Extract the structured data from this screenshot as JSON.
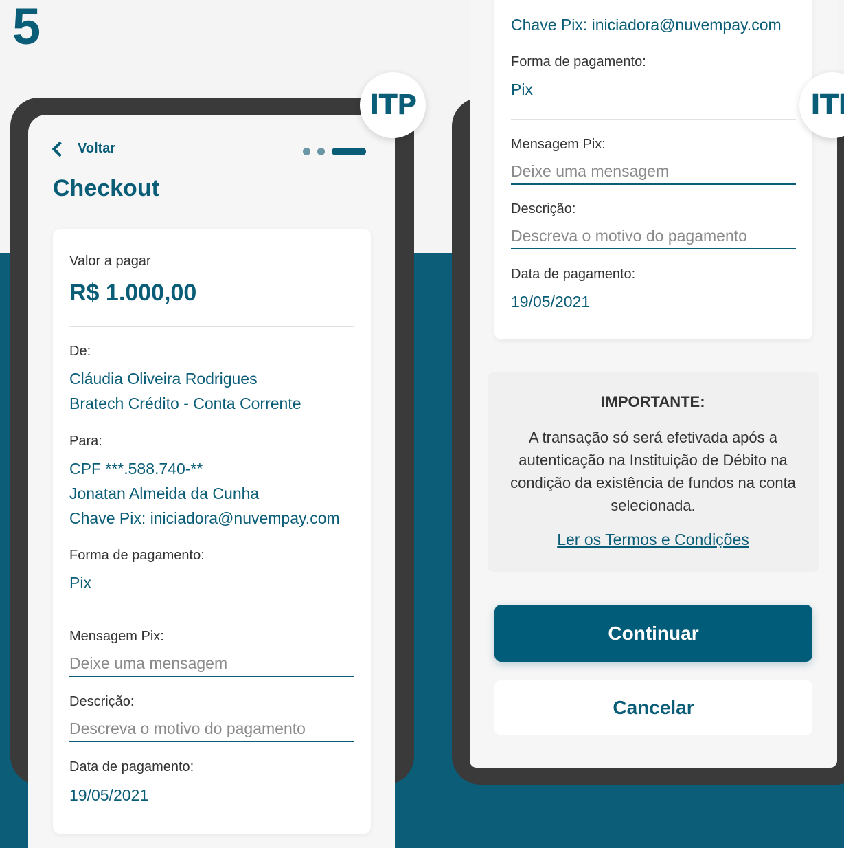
{
  "step_number": "5",
  "badge": "ITP",
  "badge_right": "ITI",
  "nav": {
    "back_label": "Voltar"
  },
  "page_title": "Checkout",
  "colors": {
    "brand": "#0a5d77",
    "background_band": "#0c5d78",
    "frame": "#3a3a3a"
  },
  "icons": {
    "back": "chevron-left-icon"
  },
  "payment": {
    "amount_label": "Valor a pagar",
    "amount": "R$ 1.000,00",
    "from_label": "De:",
    "from_name": "Cláudia Oliveira Rodrigues",
    "from_account": "Bratech Crédito - Conta Corrente",
    "to_label": "Para:",
    "to_cpf": "CPF ***.588.740-**",
    "to_name": "Jonatan Almeida da Cunha",
    "to_pix_key": "Chave Pix: iniciadora@nuvempay.com",
    "method_label": "Forma de pagamento:",
    "method": "Pix",
    "message_label": "Mensagem Pix:",
    "message_placeholder": "Deixe uma mensagem",
    "description_label": "Descrição:",
    "description_placeholder": "Descreva o motivo do pagamento",
    "date_label": "Data de pagamento:",
    "date": "19/05/2021"
  },
  "notice": {
    "title": "IMPORTANTE:",
    "body": "A transação só será efetivada após a autenticação na Instituição de Débito na condição da existência de fundos na conta selecionada.",
    "link": "Ler os Termos e Condições"
  },
  "buttons": {
    "continue": "Continuar",
    "cancel": "Cancelar"
  }
}
